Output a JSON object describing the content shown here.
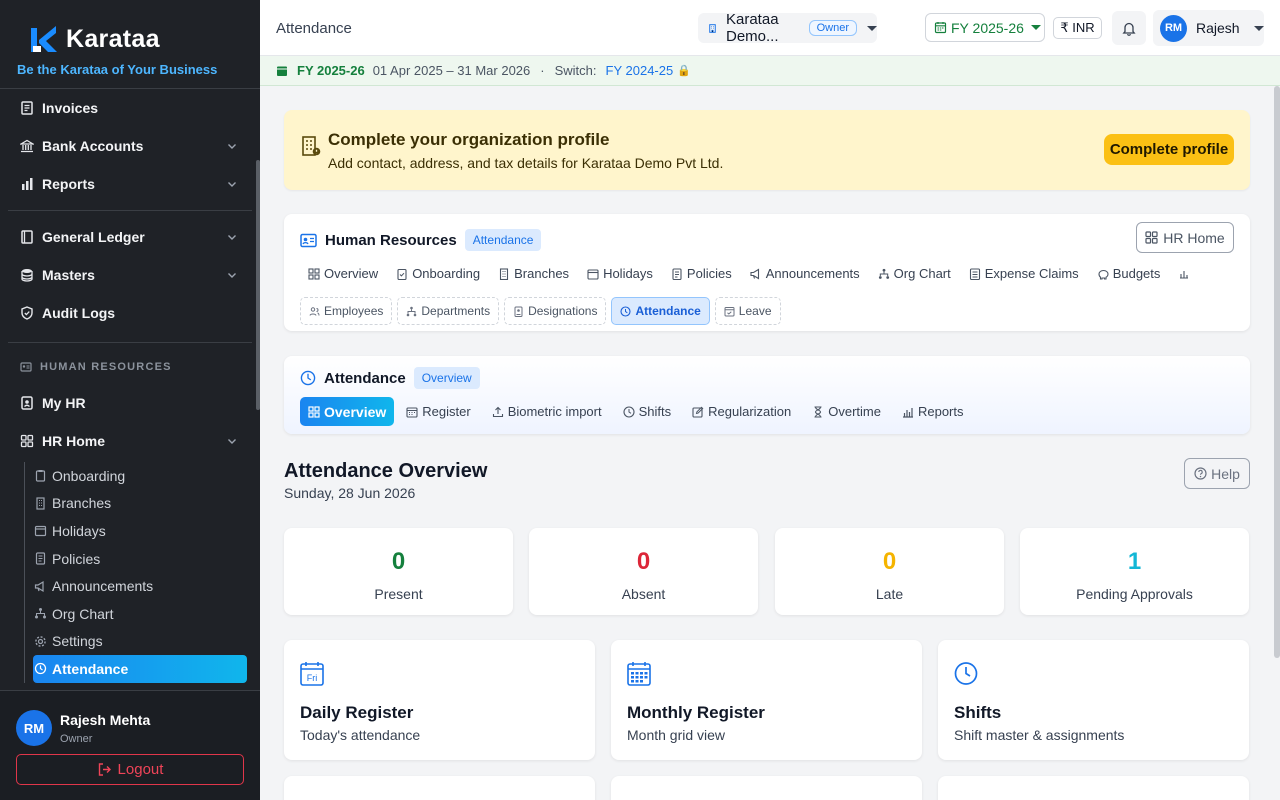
{
  "brand": {
    "name": "Karataa",
    "tagline": "Be the Karataa of Your Business"
  },
  "sidebar": {
    "items": [
      {
        "label": "Invoices"
      },
      {
        "label": "Bank Accounts"
      },
      {
        "label": "Reports"
      },
      {
        "label": "General Ledger"
      },
      {
        "label": "Masters"
      },
      {
        "label": "Audit Logs"
      }
    ],
    "section_label": "HUMAN RESOURCES",
    "my_hr": "My HR",
    "hr_home": "HR Home",
    "sub_items": [
      "Onboarding",
      "Branches",
      "Holidays",
      "Policies",
      "Announcements",
      "Org Chart",
      "Settings",
      "Attendance"
    ]
  },
  "user": {
    "initials": "RM",
    "name": "Rajesh Mehta",
    "role": "Owner",
    "logout": "Logout",
    "short_name": "Rajesh"
  },
  "topbar": {
    "title": "Attendance",
    "org": "Karataa Demo...",
    "org_badge": "Owner",
    "fy": "FY 2025-26",
    "currency": "₹ INR"
  },
  "fybar": {
    "fy": "FY 2025-26",
    "range": "01 Apr 2025 – 31 Mar 2026",
    "dot": "·",
    "switch_label": "Switch:",
    "switch_fy": "FY 2024-25",
    "lock": "🔒"
  },
  "banner": {
    "title": "Complete your organization profile",
    "subtitle": "Add contact, address, and tax details for Karataa Demo Pvt Ltd.",
    "button": "Complete profile"
  },
  "hr_card": {
    "title": "Human Resources",
    "pill": "Attendance",
    "home_button": "HR Home",
    "tabs": [
      "Overview",
      "Onboarding",
      "Branches",
      "Holidays",
      "Policies",
      "Announcements",
      "Org Chart",
      "Expense Claims",
      "Budgets"
    ],
    "sub_tabs": [
      "Employees",
      "Departments",
      "Designations",
      "Attendance",
      "Leave"
    ]
  },
  "att_card": {
    "title": "Attendance",
    "pill": "Overview",
    "tabs": [
      "Overview",
      "Register",
      "Biometric import",
      "Shifts",
      "Regularization",
      "Overtime",
      "Reports"
    ]
  },
  "overview": {
    "title": "Attendance Overview",
    "date": "Sunday, 28 Jun 2026",
    "help": "Help",
    "stats": [
      {
        "value": "0",
        "label": "Present",
        "color": "#15803d"
      },
      {
        "value": "0",
        "label": "Absent",
        "color": "#dc2638"
      },
      {
        "value": "0",
        "label": "Late",
        "color": "#f5b400"
      },
      {
        "value": "1",
        "label": "Pending Approvals",
        "color": "#13b7d6"
      }
    ],
    "cards": [
      {
        "title": "Daily Register",
        "subtitle": "Today's attendance",
        "icon_text": "Fri"
      },
      {
        "title": "Monthly Register",
        "subtitle": "Month grid view"
      },
      {
        "title": "Shifts",
        "subtitle": "Shift master & assignments"
      }
    ]
  },
  "colors": {
    "accent": "#1a73e8",
    "sidebar_bg": "#1f2227",
    "banner_bg": "#fff5cc",
    "banner_button": "#fbc014",
    "fy_green": "#15803d",
    "logout_red": "#ef4458"
  }
}
